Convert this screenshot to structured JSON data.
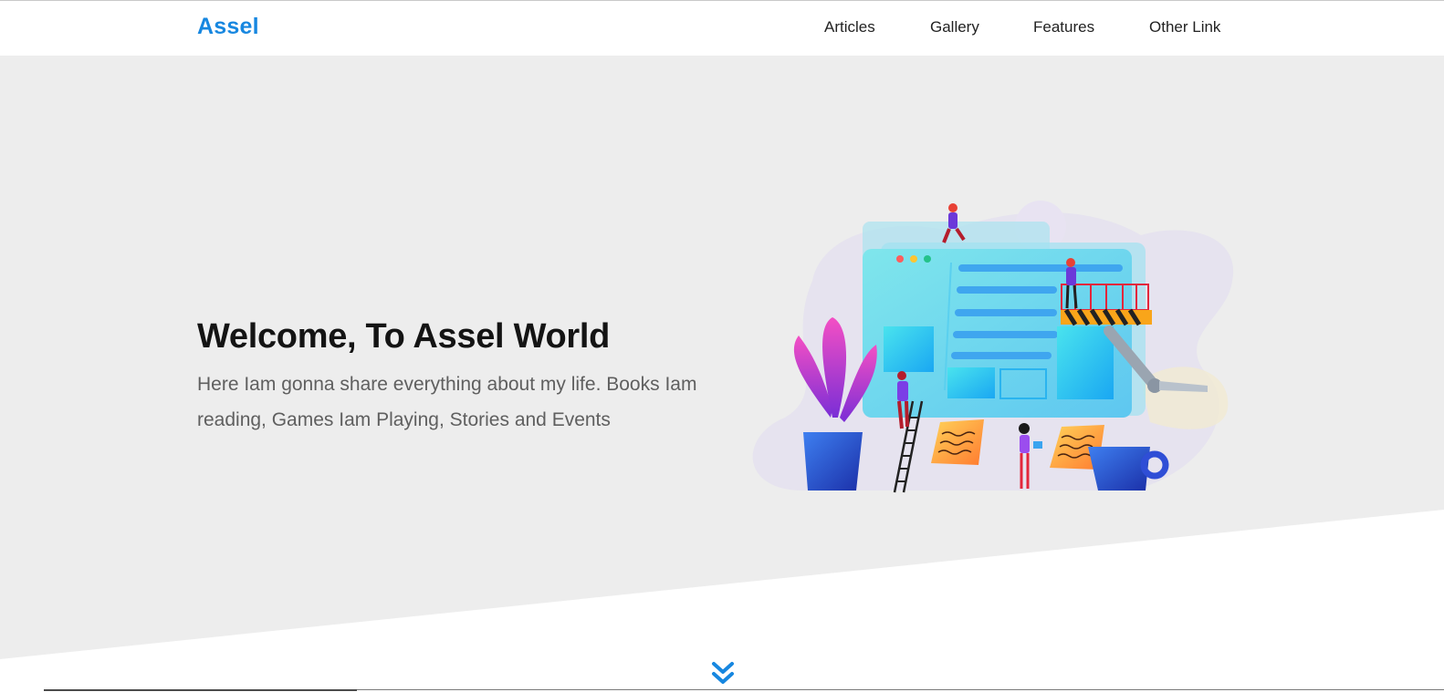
{
  "header": {
    "logo": "Assel",
    "nav": [
      {
        "label": "Articles"
      },
      {
        "label": "Gallery"
      },
      {
        "label": "Features"
      },
      {
        "label": "Other Link"
      }
    ]
  },
  "hero": {
    "title": "Welcome, To Assel World",
    "subtitle": "Here Iam gonna share everything about my life. Books Iam reading, Games Iam Playing, Stories and Events"
  },
  "icons": {
    "scroll": "double-chevron-down-icon"
  },
  "colors": {
    "brand": "#1787e0",
    "hero_bg": "#ededed",
    "title": "#141414",
    "subtitle": "#5f5f5f",
    "nav_text": "#222222"
  }
}
